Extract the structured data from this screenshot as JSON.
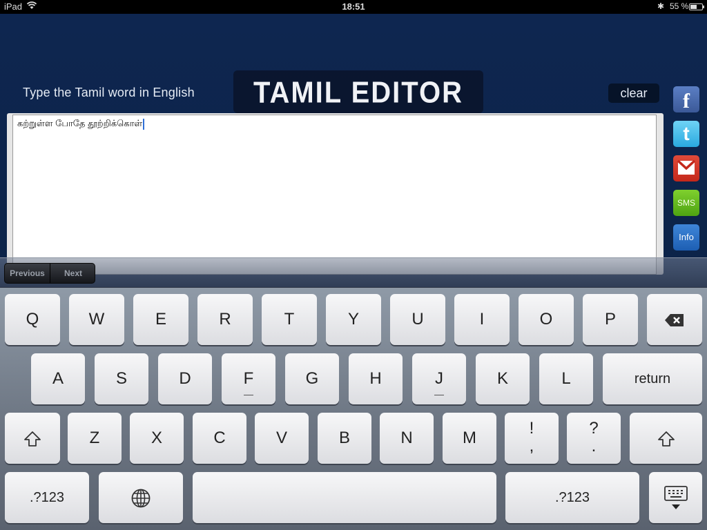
{
  "status_bar": {
    "carrier": "iPad",
    "time": "18:51",
    "battery": "55 %",
    "battery_level": 0.55,
    "bluetooth_icon": "bluetooth-icon",
    "wifi_icon": "wifi-icon"
  },
  "header": {
    "hint": "Type the Tamil word in English",
    "title": "TAMIL EDITOR",
    "clear_label": "clear"
  },
  "editor": {
    "text": "கற்றுள்ள போதே தூற்றிக்கொள்"
  },
  "share": {
    "facebook": "f",
    "twitter": "t",
    "gmail_icon": "gmail-icon",
    "sms": "SMS",
    "info": "Info"
  },
  "toolbar": {
    "previous": "Previous",
    "next": "Next"
  },
  "keyboard": {
    "row1": [
      "Q",
      "W",
      "E",
      "R",
      "T",
      "Y",
      "U",
      "I",
      "O",
      "P"
    ],
    "row2": [
      "A",
      "S",
      "D",
      "F",
      "G",
      "H",
      "J",
      "K",
      "L"
    ],
    "return": "return",
    "row3": [
      "Z",
      "X",
      "C",
      "V",
      "B",
      "N",
      "M"
    ],
    "excl_top": "!",
    "excl_bottom": ",",
    "quest_top": "?",
    "quest_bottom": ".",
    "numbers": ".?123",
    "icons": {
      "backspace": "backspace-icon",
      "shift": "shift-icon",
      "globe": "globe-icon",
      "dismiss": "keyboard-dismiss-icon"
    }
  },
  "colors": {
    "app_bg": "#0e2650",
    "editor_bg": "#ffffff",
    "caret": "#2f6fd6"
  }
}
